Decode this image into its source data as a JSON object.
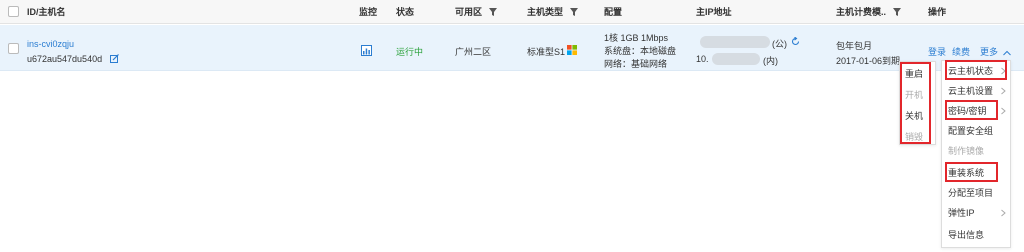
{
  "header": {
    "id_name": "ID/主机名",
    "monitor": "监控",
    "status": "状态",
    "zone": "可用区",
    "host_type": "主机类型",
    "config": "配置",
    "main_ip": "主IP地址",
    "billing": "主机计费模..",
    "actions": "操作"
  },
  "instance": {
    "id": "ins-cvi0zqju",
    "name": "u672au547du540d",
    "status": "运行中",
    "zone": "广州二区",
    "type": "标准型S1",
    "config_line1": "1核 1GB 1Mbps",
    "config_line2": "系统盘：本地磁盘",
    "config_line3": "网络：基础网络",
    "ip_public_suffix": "(公)",
    "ip_private_prefix": "10.",
    "ip_private_suffix": "(内)",
    "billing_mode": "包年包月",
    "expire": "2017-01-06到期",
    "login": "登录",
    "renew": "续费",
    "more": "更多"
  },
  "power_menu": {
    "items": [
      {
        "label": "重启",
        "disabled": false
      },
      {
        "label": "开机",
        "disabled": true
      },
      {
        "label": "关机",
        "disabled": false
      },
      {
        "label": "销毁",
        "disabled": true
      }
    ]
  },
  "more_menu": {
    "items": [
      {
        "label": "云主机状态",
        "disabled": false,
        "submenu": true
      },
      {
        "label": "云主机设置",
        "disabled": false,
        "submenu": true
      },
      {
        "label": "密码/密钥",
        "disabled": false,
        "submenu": true
      },
      {
        "label": "配置安全组",
        "disabled": false,
        "submenu": false
      },
      {
        "label": "制作镜像",
        "disabled": true,
        "submenu": false
      },
      {
        "label": "重装系统",
        "disabled": false,
        "submenu": false
      },
      {
        "label": "分配至项目",
        "disabled": false,
        "submenu": false
      },
      {
        "label": "弹性IP",
        "disabled": false,
        "submenu": true
      },
      {
        "label": "导出信息",
        "disabled": false,
        "submenu": false
      }
    ]
  },
  "colors": {
    "link": "#2b7dd1",
    "running": "#2aa13a",
    "highlight": "#e2262b"
  },
  "icons": [
    "monitor-chart-icon",
    "edit-icon",
    "refresh-icon",
    "windows-icon",
    "filter-icon",
    "chevron-up-icon",
    "chevron-right-icon"
  ]
}
